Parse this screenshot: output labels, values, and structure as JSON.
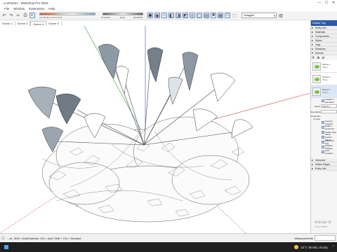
{
  "window": {
    "title": "...e-20161H - SketchUp Pro 2023",
    "controls": [
      "—",
      "☐",
      "✕"
    ]
  },
  "menu": [
    "File",
    "Window",
    "Extensions",
    "Help"
  ],
  "toolbar": {
    "shadow_scale_letters": "J  F  M  A  M  J  J  A  S  O  N  D",
    "shadow_time_left": "07:32 AM",
    "shadow_time_mid": "Noon",
    "shadow_time_right": "04:28 PM",
    "tag_select": "Untagged"
  },
  "tabs": [
    {
      "label": "Scene 2",
      "active": false
    },
    {
      "label": "Scene 3",
      "active": false
    },
    {
      "label": "Scene 4",
      "active": true
    },
    {
      "label": "Scene 5",
      "active": false
    }
  ],
  "tray": {
    "title": "Default Tray",
    "panels": [
      "Entity Info",
      "Materials",
      "Components",
      "Styles",
      "Tags",
      "Shadows"
    ],
    "scenes_panel": "Scenes",
    "scene_items": [
      {
        "name": "Scene 1",
        "desc": "Photo..."
      },
      {
        "name": "Scene 2",
        "desc": "Photo..."
      },
      {
        "name": "Scene 3",
        "desc": "Photo..."
      }
    ],
    "props": [
      {
        "label": "Name",
        "value": "Scene 4"
      },
      {
        "label": "Description",
        "value": ""
      }
    ],
    "properties_label": "Properties to save",
    "checkboxes": [
      "Include in animation",
      "Camera Location",
      "Hidden Geometry",
      "Visible Tags",
      "Active Section Planes",
      "Style and Fog",
      "Shadow Settings",
      "Axes Location"
    ],
    "bottom_panels": [
      "Instructor",
      "Soften Edges",
      "Entity Info"
    ]
  },
  "status": {
    "text": "...ck. Shift = Add/Subtract. Ctrl = Add. Shift + Ctrl = Subtract.",
    "vcb_label": "Measurements"
  },
  "watermark": {
    "line1": "Activate W",
    "line2": "Go to Settin..."
  },
  "taskbar": {
    "temp": "32°C",
    "weather": "Mostly cloudy",
    "icons": "⌃"
  }
}
